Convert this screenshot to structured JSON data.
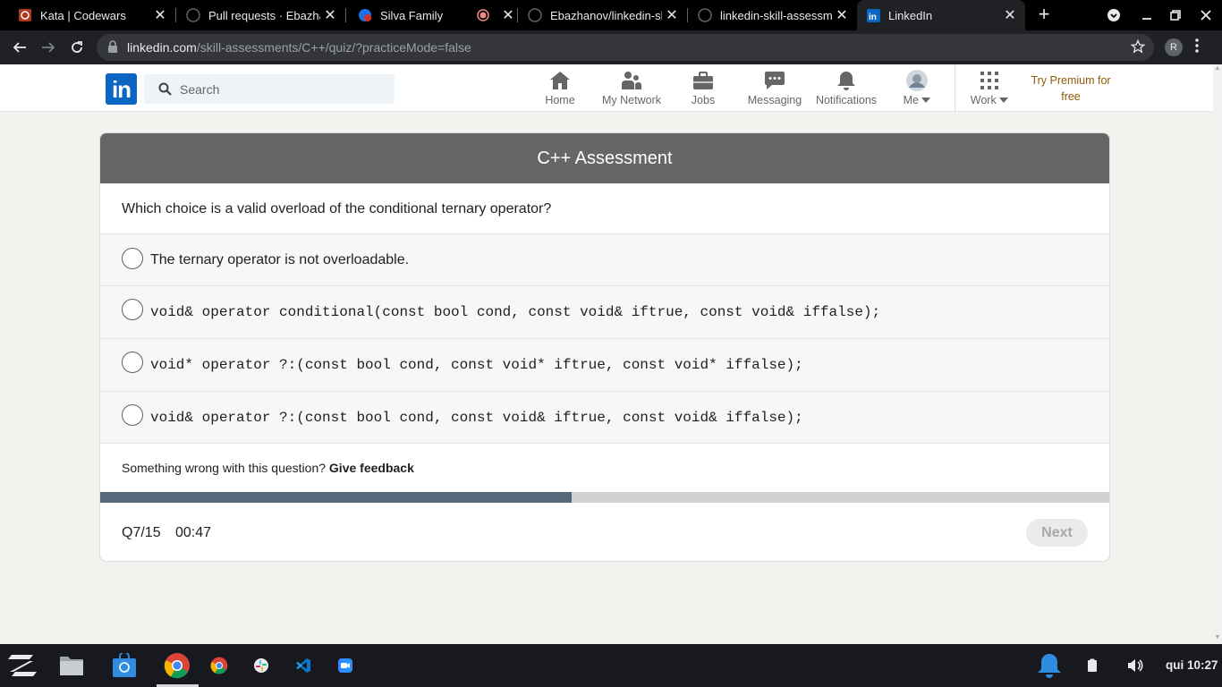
{
  "browser": {
    "tabs": [
      {
        "title": "Kata | Codewars",
        "icon": "codewars-icon",
        "active": false
      },
      {
        "title": "Pull requests · Ebazhanov",
        "icon": "github-icon",
        "active": false
      },
      {
        "title": "Silva Family",
        "icon": "meet-icon",
        "active": false
      },
      {
        "title": "",
        "icon": "recording-icon",
        "active": false
      },
      {
        "title": "Ebazhanov/linkedin-skill-assessments-quizzes",
        "icon": "github-icon",
        "active": false
      },
      {
        "title": "linkedin-skill-assessments-quizzes",
        "icon": "github-icon",
        "active": false
      },
      {
        "title": "LinkedIn",
        "icon": "linkedin-icon",
        "active": true
      }
    ],
    "address": {
      "host": "linkedin.com",
      "path": "/skill-assessments/C++/quiz/?practiceMode=false"
    },
    "profile_initial": "R"
  },
  "linkedin": {
    "logo": "in",
    "search_placeholder": "Search",
    "nav": [
      {
        "label": "Home",
        "icon": "home-icon"
      },
      {
        "label": "My Network",
        "icon": "network-icon"
      },
      {
        "label": "Jobs",
        "icon": "briefcase-icon"
      },
      {
        "label": "Messaging",
        "icon": "messaging-icon"
      },
      {
        "label": "Notifications",
        "icon": "bell-icon"
      },
      {
        "label": "Me",
        "icon": "avatar-icon"
      },
      {
        "label": "Work",
        "icon": "grid-icon"
      }
    ],
    "premium": "Try Premium for free"
  },
  "assessment": {
    "title": "C++ Assessment",
    "question": "Which choice is a valid overload of the conditional ternary operator?",
    "options": [
      {
        "text": "The ternary operator is not overloadable.",
        "code": false
      },
      {
        "text": "void& operator conditional(const bool cond, const void& iftrue, const void& iffalse);",
        "code": true
      },
      {
        "text": "void* operator ?:(const bool cond, const void* iftrue, const void* iffalse);",
        "code": true
      },
      {
        "text": "void& operator ?:(const bool cond, const void& iftrue, const void& iffalse);",
        "code": true
      }
    ],
    "feedback_prompt": "Something wrong with this question?",
    "feedback_link": "Give feedback",
    "progress_fraction": 0.467,
    "question_counter": "Q7/15",
    "timer": "00:47",
    "next_label": "Next"
  },
  "taskbar": {
    "clock": "qui 10:27"
  },
  "colors": {
    "linkedin_blue": "#0a66c2",
    "card_header": "#666666",
    "progress_fill": "#56687a",
    "premium_gold": "#915907"
  }
}
